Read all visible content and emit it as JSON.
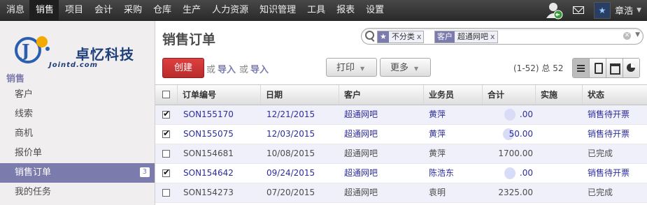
{
  "topnav": {
    "items": [
      "消息",
      "销售",
      "项目",
      "会计",
      "采购",
      "仓库",
      "生产",
      "人力资源",
      "知识管理",
      "工具",
      "报表",
      "设置"
    ],
    "active_index": 1,
    "user_name": "章浩"
  },
  "sidebar": {
    "logo_name": "卓忆科技",
    "logo_url_text": "Jointd.com",
    "section": "销售",
    "items": [
      {
        "label": "客户"
      },
      {
        "label": "线索"
      },
      {
        "label": "商机"
      },
      {
        "label": "报价单"
      },
      {
        "label": "销售订单",
        "badge": "3",
        "active": true
      },
      {
        "label": "我的任务"
      }
    ]
  },
  "main": {
    "title": "销售订单",
    "search": {
      "facets": [
        {
          "icon": "star-icon",
          "value": "不分类"
        },
        {
          "label": "客户",
          "value": "超通网吧"
        }
      ],
      "remove": "x"
    },
    "create_label": "创建",
    "or1": "或",
    "import1": "导入",
    "or2": "或",
    "import2": "导入",
    "print_label": "打印",
    "more_label": "更多",
    "pager": "(1-52) 总 52",
    "columns": [
      "订单编号",
      "日期",
      "客户",
      "业务员",
      "合计",
      "实施",
      "状态"
    ],
    "rows": [
      {
        "checked": true,
        "num": "SON155170",
        "date": "12/21/2015",
        "customer": "超通网吧",
        "salesman": "黄萍",
        "total": ".00",
        "status": "销售待开票"
      },
      {
        "checked": true,
        "num": "SON155075",
        "date": "12/03/2015",
        "customer": "超通网吧",
        "salesman": "黄萍",
        "total": "50.00",
        "status": "销售待开票"
      },
      {
        "checked": false,
        "num": "SON154681",
        "date": "10/08/2015",
        "customer": "超通网吧",
        "salesman": "黄萍",
        "total": "1700.00",
        "status": "已完成"
      },
      {
        "checked": true,
        "num": "SON154642",
        "date": "09/24/2015",
        "customer": "超通网吧",
        "salesman": "陈浩东",
        "total": ".00",
        "status": "销售待开票"
      },
      {
        "checked": false,
        "num": "SON154273",
        "date": "07/20/2015",
        "customer": "超通网吧",
        "salesman": "袁明",
        "total": "2325.00",
        "status": "已完成"
      }
    ]
  },
  "colors": {
    "accent": "#7c7bad",
    "create": "#c93535",
    "selected_text": "#2c2c9e"
  }
}
